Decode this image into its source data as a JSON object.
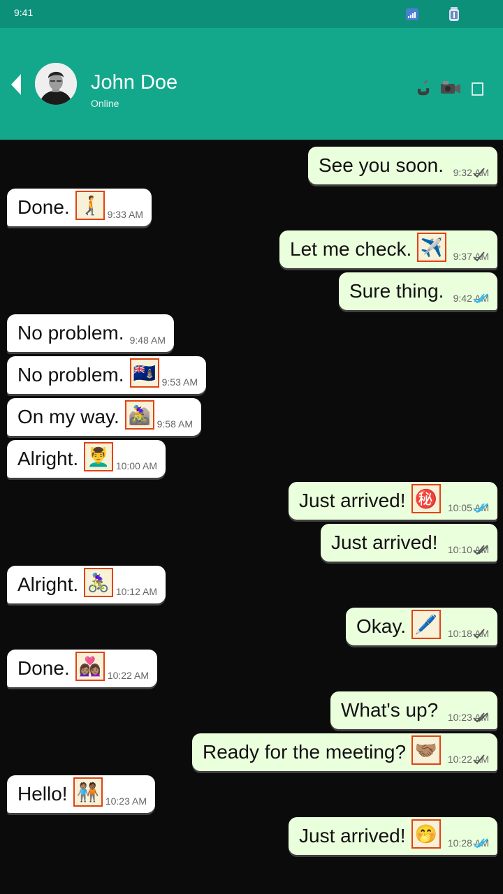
{
  "status_bar": {
    "time": "9:41",
    "icons": [
      "signal-icon",
      "battery-icon"
    ]
  },
  "header": {
    "contact_name": "John Doe",
    "contact_status": "Online",
    "icons": [
      "back-icon",
      "avatar",
      "call-icon",
      "video-icon",
      "menu-icon"
    ]
  },
  "colors": {
    "status_bar": "#0d9079",
    "header": "#13a88c",
    "chat_background": "#0b0b0b",
    "incoming_bubble": "#ffffff",
    "outgoing_bubble": "#eaffdc",
    "read_tick": "#34b7f1",
    "emoji_outline": "#e34213"
  },
  "messages": [
    {
      "direction": "out",
      "text": "See you soon.",
      "emoji": null,
      "time": "9:32 AM",
      "status": "sent"
    },
    {
      "direction": "in",
      "text": "Done.",
      "emoji": "🚶‍➡️",
      "time": "9:33 AM"
    },
    {
      "direction": "out",
      "text": "Let me check.",
      "emoji": "✈️",
      "time": "9:37 AM",
      "status": "sent"
    },
    {
      "direction": "out",
      "text": "Sure thing.",
      "emoji": null,
      "time": "9:42 AM",
      "status": "read"
    },
    {
      "direction": "in",
      "text": "No problem.",
      "emoji": null,
      "time": "9:48 AM"
    },
    {
      "direction": "in",
      "text": "No problem.",
      "emoji": "🇰🇾",
      "time": "9:53 AM"
    },
    {
      "direction": "in",
      "text": "On my way.",
      "emoji": "🚵‍♀️",
      "time": "9:58 AM"
    },
    {
      "direction": "in",
      "text": "Alright.",
      "emoji": "💆‍♂️",
      "time": "10:00 AM"
    },
    {
      "direction": "out",
      "text": "Just arrived!",
      "emoji": "㊙️",
      "time": "10:05 AM",
      "status": "read"
    },
    {
      "direction": "out",
      "text": "Just arrived!",
      "emoji": null,
      "time": "10:10 AM",
      "status": "delivered"
    },
    {
      "direction": "in",
      "text": "Alright.",
      "emoji": "🚴🏽‍♀️",
      "time": "10:12 AM"
    },
    {
      "direction": "out",
      "text": "Okay.",
      "emoji": "🖊️",
      "time": "10:18 AM",
      "status": "sent"
    },
    {
      "direction": "in",
      "text": "Done.",
      "emoji": "👩🏽‍❤️‍👩🏽",
      "time": "10:22 AM"
    },
    {
      "direction": "out",
      "text": "What's up?",
      "emoji": null,
      "time": "10:23 AM",
      "status": "delivered"
    },
    {
      "direction": "out",
      "text": "Ready for the meeting?",
      "emoji": "🤝🏽",
      "time": "10:22 AM",
      "status": "sent"
    },
    {
      "direction": "in",
      "text": "Hello!",
      "emoji": "🧑🏽‍🤝‍🧑🏾",
      "time": "10:23 AM"
    },
    {
      "direction": "out",
      "text": "Just arrived!",
      "emoji": "🤭",
      "time": "10:28 AM",
      "status": "read"
    }
  ]
}
